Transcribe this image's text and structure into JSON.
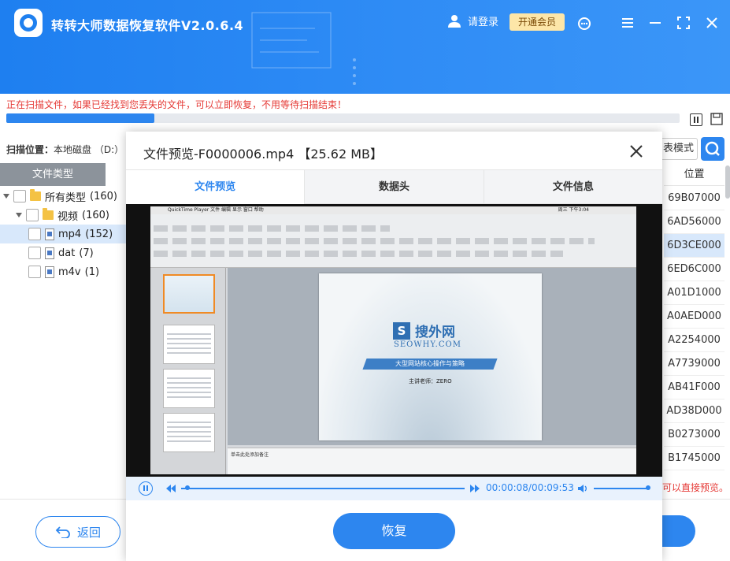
{
  "app": {
    "title": "转转大师数据恢复软件V2.0.6.4",
    "login_label": "请登录",
    "vip_label": "开通会员"
  },
  "scan": {
    "status_text": "正在扫描文件，如果已经找到您丢失的文件，可以立即恢复，不用等待扫描结束！",
    "progress": 0.22,
    "location_label": "扫描位置：",
    "location_value": "本地磁盘 （D:）"
  },
  "toolbar": {
    "mode_label": "表模式"
  },
  "tree": {
    "header": "文件类型",
    "items": [
      {
        "label": "所有类型",
        "count": "(160)"
      },
      {
        "label": "视频",
        "count": "(160)"
      },
      {
        "label": "mp4",
        "count": "(152)"
      },
      {
        "label": "dat",
        "count": "(7)"
      },
      {
        "label": "m4v",
        "count": "(1)"
      }
    ]
  },
  "table": {
    "position_header": "位置",
    "positions": [
      "69B07000",
      "6AD56000",
      "6D3CE000",
      "6ED6C000",
      "A01D1000",
      "A0AED000",
      "A2254000",
      "A7739000",
      "AB41F000",
      "AD38D000",
      "B0273000",
      "B1745000"
    ],
    "selected_index": 2
  },
  "hint_right": "可以直接预览。",
  "bottom": {
    "back_label": "返回"
  },
  "modal": {
    "title": "文件预览-F0000006.mp4 【25.62 MB】",
    "tabs": [
      "文件预览",
      "数据头",
      "文件信息"
    ],
    "active_tab": 0,
    "player": {
      "time": "00:00:08/00:09:53",
      "progress": 0.014,
      "volume": 1.0
    },
    "recover_label": "恢复",
    "video_content": {
      "menubar_text": "QuickTime Player  文件  编辑  显示  窗口  帮助",
      "clock_text": "周三 下午3:04",
      "slide_logo_s": "S",
      "slide_logo_text": "搜外网",
      "slide_sub": "SEOWHY.COM",
      "slide_banner": "大型网站核心操作与策略",
      "slide_author": "主讲老师：ZERO",
      "notes_text": "单击此处添加备注"
    }
  },
  "colors": {
    "accent": "#2d86ef",
    "warning": "#e53935",
    "vip": "#fde6a8"
  }
}
